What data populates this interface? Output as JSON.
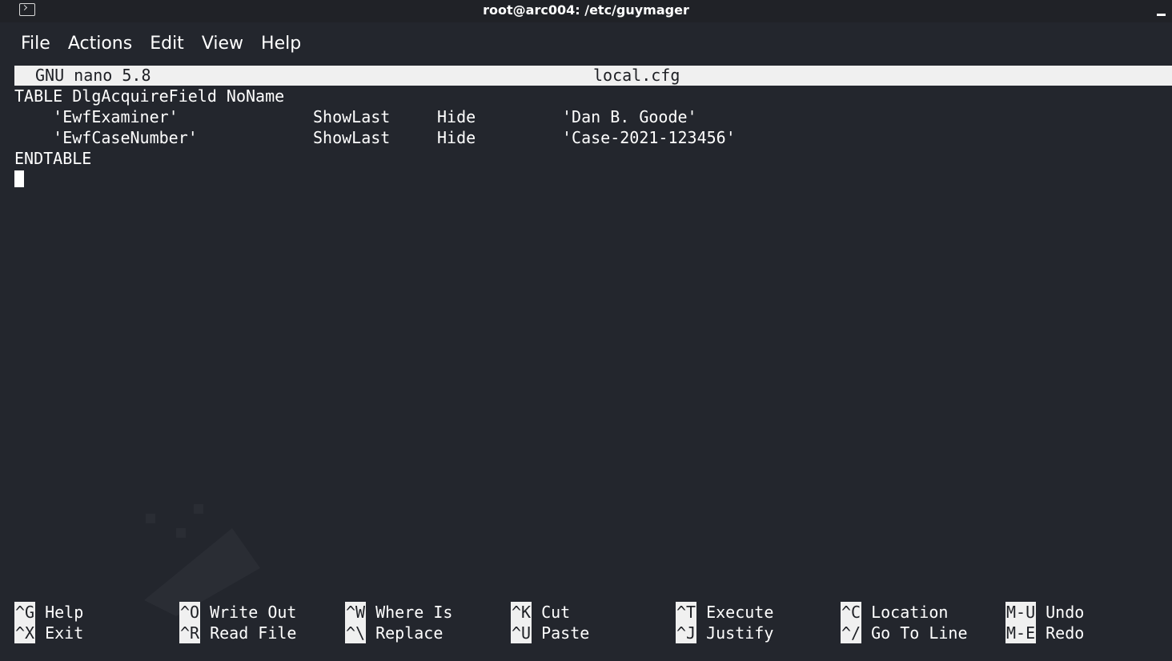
{
  "window": {
    "title": "root@arc004: /etc/guymager",
    "app_icon": "terminal-icon",
    "minimize_icon": "minimize-icon"
  },
  "menu": [
    "File",
    "Actions",
    "Edit",
    "View",
    "Help"
  ],
  "nano": {
    "version": "GNU nano 5.8",
    "filename": "local.cfg"
  },
  "editor": {
    "lines": [
      {
        "c1": "TABLE DlgAcquireField NoName",
        "c2": "",
        "c3": "",
        "c4": ""
      },
      {
        "c1": "    'EwfExaminer'",
        "c2": "ShowLast",
        "c3": "Hide",
        "c4": "'Dan B. Goode'"
      },
      {
        "c1": "    'EwfCaseNumber'",
        "c2": "ShowLast",
        "c3": "Hide",
        "c4": "'Case-2021-123456'"
      },
      {
        "c1": "ENDTABLE",
        "c2": "",
        "c3": "",
        "c4": ""
      }
    ]
  },
  "shortcuts": [
    {
      "key": "^G",
      "label": "Help"
    },
    {
      "key": "^X",
      "label": "Exit"
    },
    {
      "key": "^O",
      "label": "Write Out"
    },
    {
      "key": "^R",
      "label": "Read File"
    },
    {
      "key": "^W",
      "label": "Where Is"
    },
    {
      "key": "^\\",
      "label": "Replace"
    },
    {
      "key": "^K",
      "label": "Cut"
    },
    {
      "key": "^U",
      "label": "Paste"
    },
    {
      "key": "^T",
      "label": "Execute"
    },
    {
      "key": "^J",
      "label": "Justify"
    },
    {
      "key": "^C",
      "label": "Location"
    },
    {
      "key": "^/",
      "label": "Go To Line"
    },
    {
      "key": "M-U",
      "label": "Undo"
    },
    {
      "key": "M-E",
      "label": "Redo"
    }
  ],
  "colors": {
    "background": "#23262d",
    "titlebar": "#202227",
    "header_bg": "#f0f0f0",
    "text": "#ffffff"
  }
}
